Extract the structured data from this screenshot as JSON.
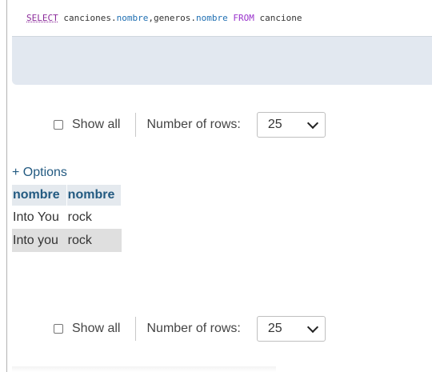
{
  "sql": {
    "kw_select": "SELECT",
    "part1": " canciones.",
    "col1": "nombre",
    "part2": ",generos.",
    "col2": "nombre",
    "part3": " ",
    "kw_from": "FROM",
    "part4": " cancione"
  },
  "navigation_top": {
    "show_all_label": "Show all",
    "rows_label": "Number of rows:",
    "rows_value": "25"
  },
  "options_link": "+ Options",
  "results": {
    "headers": [
      "nombre",
      "nombre"
    ],
    "rows": [
      [
        "Into You",
        "rock"
      ],
      [
        "Into you",
        "rock"
      ]
    ]
  },
  "navigation_bottom": {
    "show_all_label": "Show all",
    "rows_label": "Number of rows:",
    "rows_value": "25"
  },
  "colors": {
    "sql_keyword": "#9932cc",
    "sql_column": "#1f6fb2",
    "link": "#235a81",
    "header_bg": "#e4e9ee",
    "even_row_bg": "#dfdfdf"
  }
}
